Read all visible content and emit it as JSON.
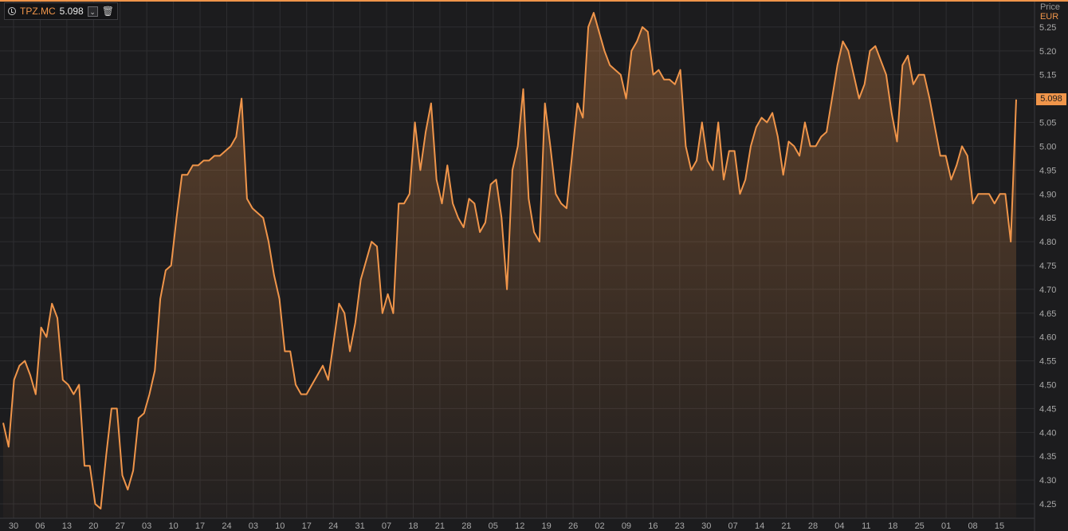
{
  "legend": {
    "symbol": "TPZ.MC",
    "value": "5.098",
    "icons": [
      "clock-icon",
      "chevron-down-icon",
      "trash-icon"
    ]
  },
  "price_axis": {
    "title": "Price",
    "currency": "EUR",
    "last_price_label": "5.098"
  },
  "colors": {
    "background": "#1c1c1e",
    "line": "#f0954a",
    "grid": "#2e2e31",
    "axis_text": "#a9a9a9"
  },
  "chart_data": {
    "type": "area",
    "title": "",
    "xlabel": "",
    "ylabel": "Price",
    "ylim": [
      4.22,
      5.3
    ],
    "yticks": [
      4.25,
      4.3,
      4.35,
      4.4,
      4.45,
      4.5,
      4.55,
      4.6,
      4.65,
      4.7,
      4.75,
      4.8,
      4.85,
      4.9,
      4.95,
      5.0,
      5.05,
      5.1,
      5.15,
      5.2,
      5.25
    ],
    "ytick_labels": [
      "4.25",
      "4.30",
      "4.35",
      "4.40",
      "4.45",
      "4.50",
      "4.55",
      "4.60",
      "4.65",
      "4.70",
      "4.75",
      "4.80",
      "4.85",
      "4.90",
      "4.95",
      "5.00",
      "5.05",
      "5.10",
      "5.15",
      "5.20",
      "5.25"
    ],
    "xtick_labels": [
      "30",
      "06",
      "13",
      "20",
      "27",
      "03",
      "10",
      "17",
      "24",
      "03",
      "10",
      "17",
      "24",
      "31",
      "07",
      "18",
      "21",
      "28",
      "05",
      "12",
      "19",
      "26",
      "02",
      "09",
      "16",
      "23",
      "30",
      "07",
      "14",
      "21",
      "28",
      "04",
      "11",
      "18",
      "25",
      "01",
      "08",
      "15"
    ],
    "grid": true,
    "series": [
      {
        "values": [
          4.42,
          4.37,
          4.51,
          4.54,
          4.55,
          4.52,
          4.48,
          4.62,
          4.6,
          4.67,
          4.64,
          4.51,
          4.5,
          4.48,
          4.5,
          4.33,
          4.33,
          4.25,
          4.24,
          4.35,
          4.45,
          4.45,
          4.31,
          4.28,
          4.32,
          4.43,
          4.44,
          4.48,
          4.53,
          4.68,
          4.74,
          4.75,
          4.85,
          4.94,
          4.94,
          4.96,
          4.96,
          4.97,
          4.97,
          4.98,
          4.98,
          4.99,
          5.0,
          5.02,
          5.1,
          4.89,
          4.87,
          4.86,
          4.85,
          4.8,
          4.73,
          4.68,
          4.57,
          4.57,
          4.5,
          4.48,
          4.48,
          4.5,
          4.52,
          4.54,
          4.51,
          4.59,
          4.67,
          4.65,
          4.57,
          4.63,
          4.72,
          4.76,
          4.8,
          4.79,
          4.65,
          4.69,
          4.65,
          4.88,
          4.88,
          4.9,
          5.05,
          4.95,
          5.03,
          5.09,
          4.93,
          4.88,
          4.96,
          4.88,
          4.85,
          4.83,
          4.89,
          4.88,
          4.82,
          4.84,
          4.92,
          4.93,
          4.85,
          4.7,
          4.95,
          5.0,
          5.12,
          4.89,
          4.82,
          4.8,
          5.09,
          5.0,
          4.9,
          4.88,
          4.87,
          4.98,
          5.09,
          5.06,
          5.25,
          5.28,
          5.24,
          5.2,
          5.17,
          5.16,
          5.15,
          5.1,
          5.2,
          5.22,
          5.25,
          5.24,
          5.15,
          5.16,
          5.14,
          5.14,
          5.13,
          5.16,
          5.0,
          4.95,
          4.97,
          5.05,
          4.97,
          4.95,
          5.05,
          4.93,
          4.99,
          4.99,
          4.9,
          4.93,
          5.0,
          5.04,
          5.06,
          5.05,
          5.07,
          5.02,
          4.94,
          5.01,
          5.0,
          4.98,
          5.05,
          5.0,
          5.0,
          5.02,
          5.03,
          5.1,
          5.17,
          5.22,
          5.2,
          5.15,
          5.1,
          5.13,
          5.2,
          5.21,
          5.18,
          5.15,
          5.07,
          5.01,
          5.17,
          5.19,
          5.13,
          5.15,
          5.15,
          5.1,
          5.04,
          4.98,
          4.98,
          4.93,
          4.96,
          5.0,
          4.98,
          4.88,
          4.9,
          4.9,
          4.9,
          4.88,
          4.9,
          4.9,
          4.8,
          5.098
        ]
      }
    ]
  }
}
